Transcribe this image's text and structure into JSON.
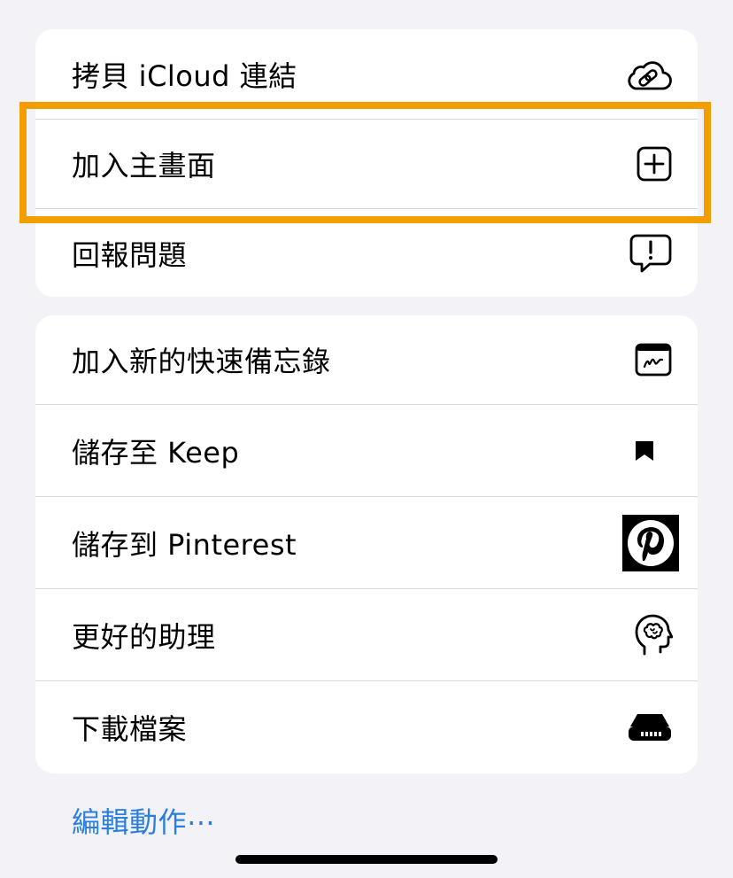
{
  "group1": {
    "items": [
      {
        "label": "拷貝 iCloud 連結",
        "icon": "icloud-link-icon"
      },
      {
        "label": "加入主畫面",
        "icon": "add-square-icon"
      },
      {
        "label": "回報問題",
        "icon": "exclamation-bubble-icon"
      }
    ]
  },
  "group2": {
    "items": [
      {
        "label": "加入新的快速備忘錄",
        "icon": "quick-note-icon"
      },
      {
        "label": "儲存至 Keep",
        "icon": "bookmark-icon"
      },
      {
        "label": "儲存到 Pinterest",
        "icon": "pinterest-icon"
      },
      {
        "label": "更好的助理",
        "icon": "brain-head-icon"
      },
      {
        "label": "下載檔案",
        "icon": "drive-icon"
      }
    ]
  },
  "edit_actions_label": "編輯動作⋯",
  "colors": {
    "highlight": "#f29d00",
    "link": "#2b7fe0",
    "background": "#f2f2f7"
  }
}
